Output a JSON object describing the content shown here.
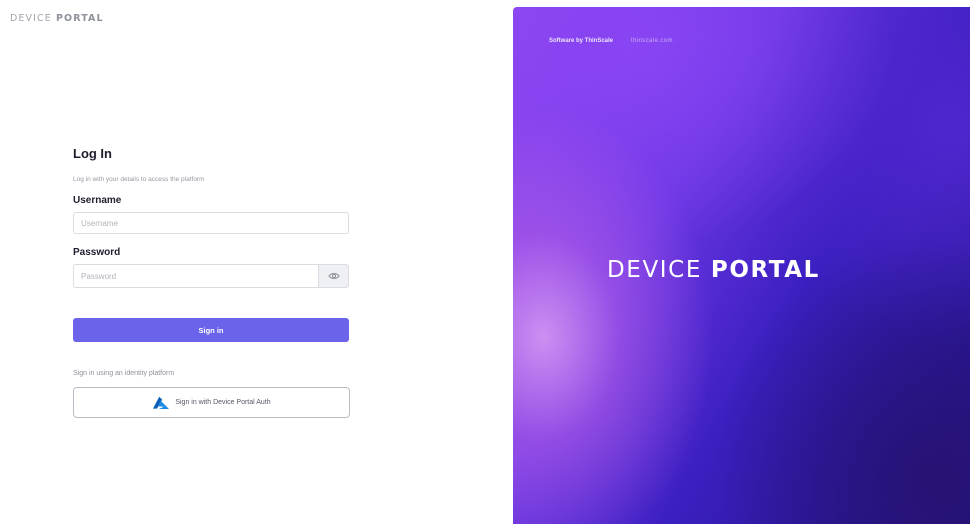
{
  "header": {
    "brand_light": "DEVICE",
    "brand_bold": "PORTAL"
  },
  "login": {
    "title": "Log In",
    "subtitle": "Log in with your details to access the platform",
    "username_label": "Username",
    "username_placeholder": "Username",
    "username_value": "",
    "password_label": "Password",
    "password_placeholder": "Password",
    "password_value": "",
    "toggle_icon": "eye-icon",
    "signin_label": "Sign in",
    "identity_label": "Sign in using an identity platform",
    "identity_button_label": "Sign in with Device Portal Auth",
    "identity_icon": "azure-logo-icon"
  },
  "hero": {
    "software_by": "Software by ThinScale",
    "website": "thinscale.com",
    "brand_light": "DEVICE",
    "brand_bold": "PORTAL"
  },
  "colors": {
    "accent": "#6b63e9",
    "hero_gradient_start": "#8e46ee",
    "hero_gradient_end": "#22137f"
  }
}
